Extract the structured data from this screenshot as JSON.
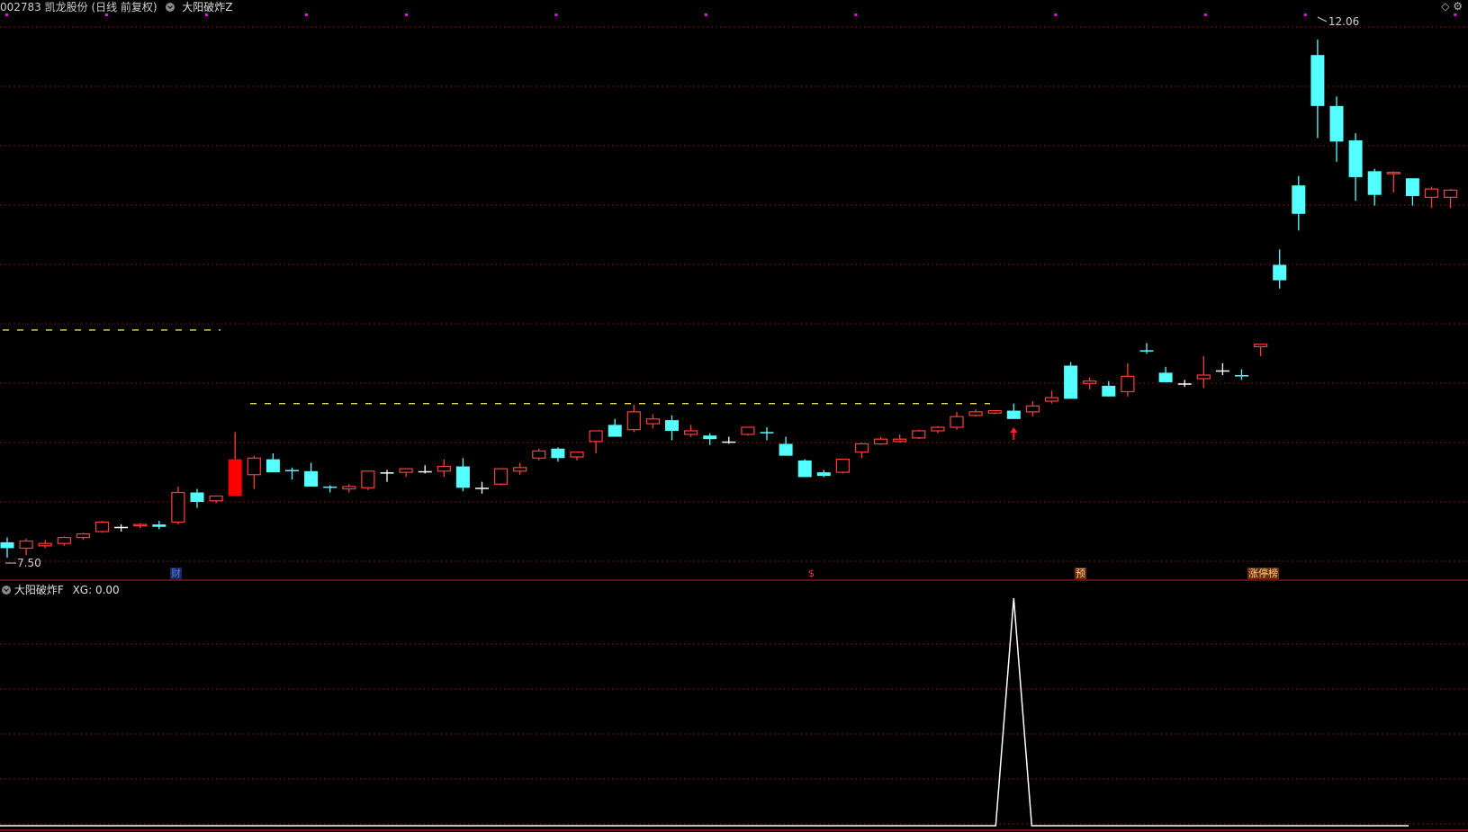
{
  "header": {
    "stock": "002783 凯龙股份 (日线 前复权)",
    "indicator": "大阳破炸Z"
  },
  "sub_header": {
    "indicator": "大阳破炸F",
    "xg_label": "XG: 0.00"
  },
  "events": [
    {
      "label": "财",
      "color": "#4e7dff",
      "bg": "#1a2a55"
    },
    {
      "label": "$",
      "color": "#ff3030",
      "bg": "#000000"
    },
    {
      "label": "预",
      "color": "#ffd27a",
      "bg": "#6a2a10"
    },
    {
      "label": "涨停榜",
      "color": "#ffd27a",
      "bg": "#6a2a10"
    }
  ],
  "colors": {
    "up": "#ff3b3b",
    "down": "#54ffff",
    "doji": "#ffffff",
    "grid": "#7a1010",
    "marker": "#ff00ff",
    "resistance": "#e8e04a",
    "xg_line": "#ffffff"
  },
  "chart_data": [
    {
      "type": "candlestick",
      "title": "002783 凯龙股份 (日线 前复权)",
      "high_label": "12.06",
      "low_label": "7.50",
      "ylim": [
        7.5,
        12.06
      ],
      "ohlc": [
        [
          7.63,
          7.67,
          7.5,
          7.58
        ],
        [
          7.58,
          7.66,
          7.52,
          7.64
        ],
        [
          7.6,
          7.65,
          7.58,
          7.62
        ],
        [
          7.62,
          7.68,
          7.6,
          7.67
        ],
        [
          7.67,
          7.71,
          7.65,
          7.7
        ],
        [
          7.72,
          7.81,
          7.71,
          7.8
        ],
        [
          7.76,
          7.78,
          7.72,
          7.76
        ],
        [
          7.77,
          7.79,
          7.75,
          7.78
        ],
        [
          7.78,
          7.81,
          7.74,
          7.76
        ],
        [
          7.8,
          8.1,
          7.78,
          8.05
        ],
        [
          8.05,
          8.08,
          7.92,
          7.97
        ],
        [
          7.98,
          8.02,
          7.96,
          8.02
        ],
        [
          8.02,
          8.56,
          8.07,
          8.33
        ],
        [
          8.2,
          8.36,
          8.08,
          8.34
        ],
        [
          8.33,
          8.38,
          8.25,
          8.22
        ],
        [
          8.24,
          8.26,
          8.16,
          8.23
        ],
        [
          8.23,
          8.3,
          8.14,
          8.1
        ],
        [
          8.1,
          8.11,
          8.05,
          8.09
        ],
        [
          8.08,
          8.12,
          8.05,
          8.1
        ],
        [
          8.09,
          8.23,
          8.07,
          8.23
        ],
        [
          8.22,
          8.24,
          8.14,
          8.22
        ],
        [
          8.22,
          8.25,
          8.18,
          8.25
        ],
        [
          8.23,
          8.28,
          8.21,
          8.23
        ],
        [
          8.23,
          8.33,
          8.18,
          8.27
        ],
        [
          8.27,
          8.34,
          8.06,
          8.09
        ],
        [
          8.09,
          8.14,
          8.04,
          8.09
        ],
        [
          8.12,
          8.25,
          8.11,
          8.25
        ],
        [
          8.23,
          8.3,
          8.2,
          8.26
        ],
        [
          8.34,
          8.42,
          8.32,
          8.4
        ],
        [
          8.42,
          8.43,
          8.31,
          8.34
        ],
        [
          8.35,
          8.39,
          8.32,
          8.39
        ],
        [
          8.48,
          8.57,
          8.38,
          8.57
        ],
        [
          8.62,
          8.67,
          8.52,
          8.52
        ],
        [
          8.58,
          8.79,
          8.56,
          8.73
        ],
        [
          8.63,
          8.71,
          8.59,
          8.67
        ],
        [
          8.66,
          8.7,
          8.49,
          8.57
        ],
        [
          8.54,
          8.62,
          8.52,
          8.57
        ],
        [
          8.53,
          8.55,
          8.45,
          8.5
        ],
        [
          8.48,
          8.52,
          8.46,
          8.48
        ],
        [
          8.54,
          8.6,
          8.53,
          8.6
        ],
        [
          8.56,
          8.6,
          8.49,
          8.55
        ],
        [
          8.46,
          8.52,
          8.38,
          8.36
        ],
        [
          8.32,
          8.33,
          8.18,
          8.18
        ],
        [
          8.22,
          8.24,
          8.18,
          8.19
        ],
        [
          8.22,
          8.33,
          8.21,
          8.33
        ],
        [
          8.39,
          8.47,
          8.34,
          8.46
        ],
        [
          8.46,
          8.52,
          8.45,
          8.5
        ],
        [
          8.48,
          8.54,
          8.47,
          8.5
        ],
        [
          8.51,
          8.58,
          8.5,
          8.57
        ],
        [
          8.57,
          8.61,
          8.55,
          8.6
        ],
        [
          8.6,
          8.73,
          8.58,
          8.69
        ],
        [
          8.7,
          8.75,
          8.69,
          8.73
        ],
        [
          8.72,
          8.74,
          8.71,
          8.74
        ],
        [
          8.74,
          8.8,
          8.67,
          8.67
        ],
        [
          8.73,
          8.82,
          8.69,
          8.78
        ],
        [
          8.82,
          8.91,
          8.8,
          8.85
        ],
        [
          9.12,
          9.15,
          8.86,
          8.84
        ],
        [
          8.97,
          9.02,
          8.92,
          8.99
        ],
        [
          8.95,
          8.99,
          8.87,
          8.86
        ],
        [
          8.9,
          9.14,
          8.86,
          9.03
        ],
        [
          9.25,
          9.31,
          9.22,
          9.24
        ],
        [
          9.06,
          9.11,
          8.99,
          8.98
        ],
        [
          8.97,
          9.0,
          8.94,
          8.97
        ],
        [
          9.01,
          9.2,
          8.93,
          9.04
        ],
        [
          9.08,
          9.14,
          9.04,
          9.08
        ],
        [
          9.04,
          9.09,
          9.0,
          9.03
        ],
        [
          9.28,
          9.3,
          9.2,
          9.3
        ],
        [
          9.97,
          10.1,
          9.77,
          9.84
        ],
        [
          10.64,
          10.72,
          10.26,
          10.4
        ],
        [
          11.74,
          11.87,
          11.04,
          11.31
        ],
        [
          11.31,
          11.39,
          10.84,
          11.01
        ],
        [
          11.02,
          11.08,
          10.51,
          10.71
        ],
        [
          10.76,
          10.78,
          10.47,
          10.56
        ],
        [
          10.74,
          10.76,
          10.58,
          10.75
        ],
        [
          10.7,
          10.6,
          10.47,
          10.55
        ],
        [
          10.54,
          10.63,
          10.45,
          10.61
        ],
        [
          10.54,
          10.61,
          10.45,
          10.6
        ]
      ],
      "signal_markers_count": 23,
      "resistance_levels": [
        9.42,
        8.8
      ]
    },
    {
      "type": "line",
      "series": [
        {
          "name": "XG",
          "values_peak_index": 53,
          "peak": 1,
          "baseline": 0
        }
      ]
    }
  ]
}
